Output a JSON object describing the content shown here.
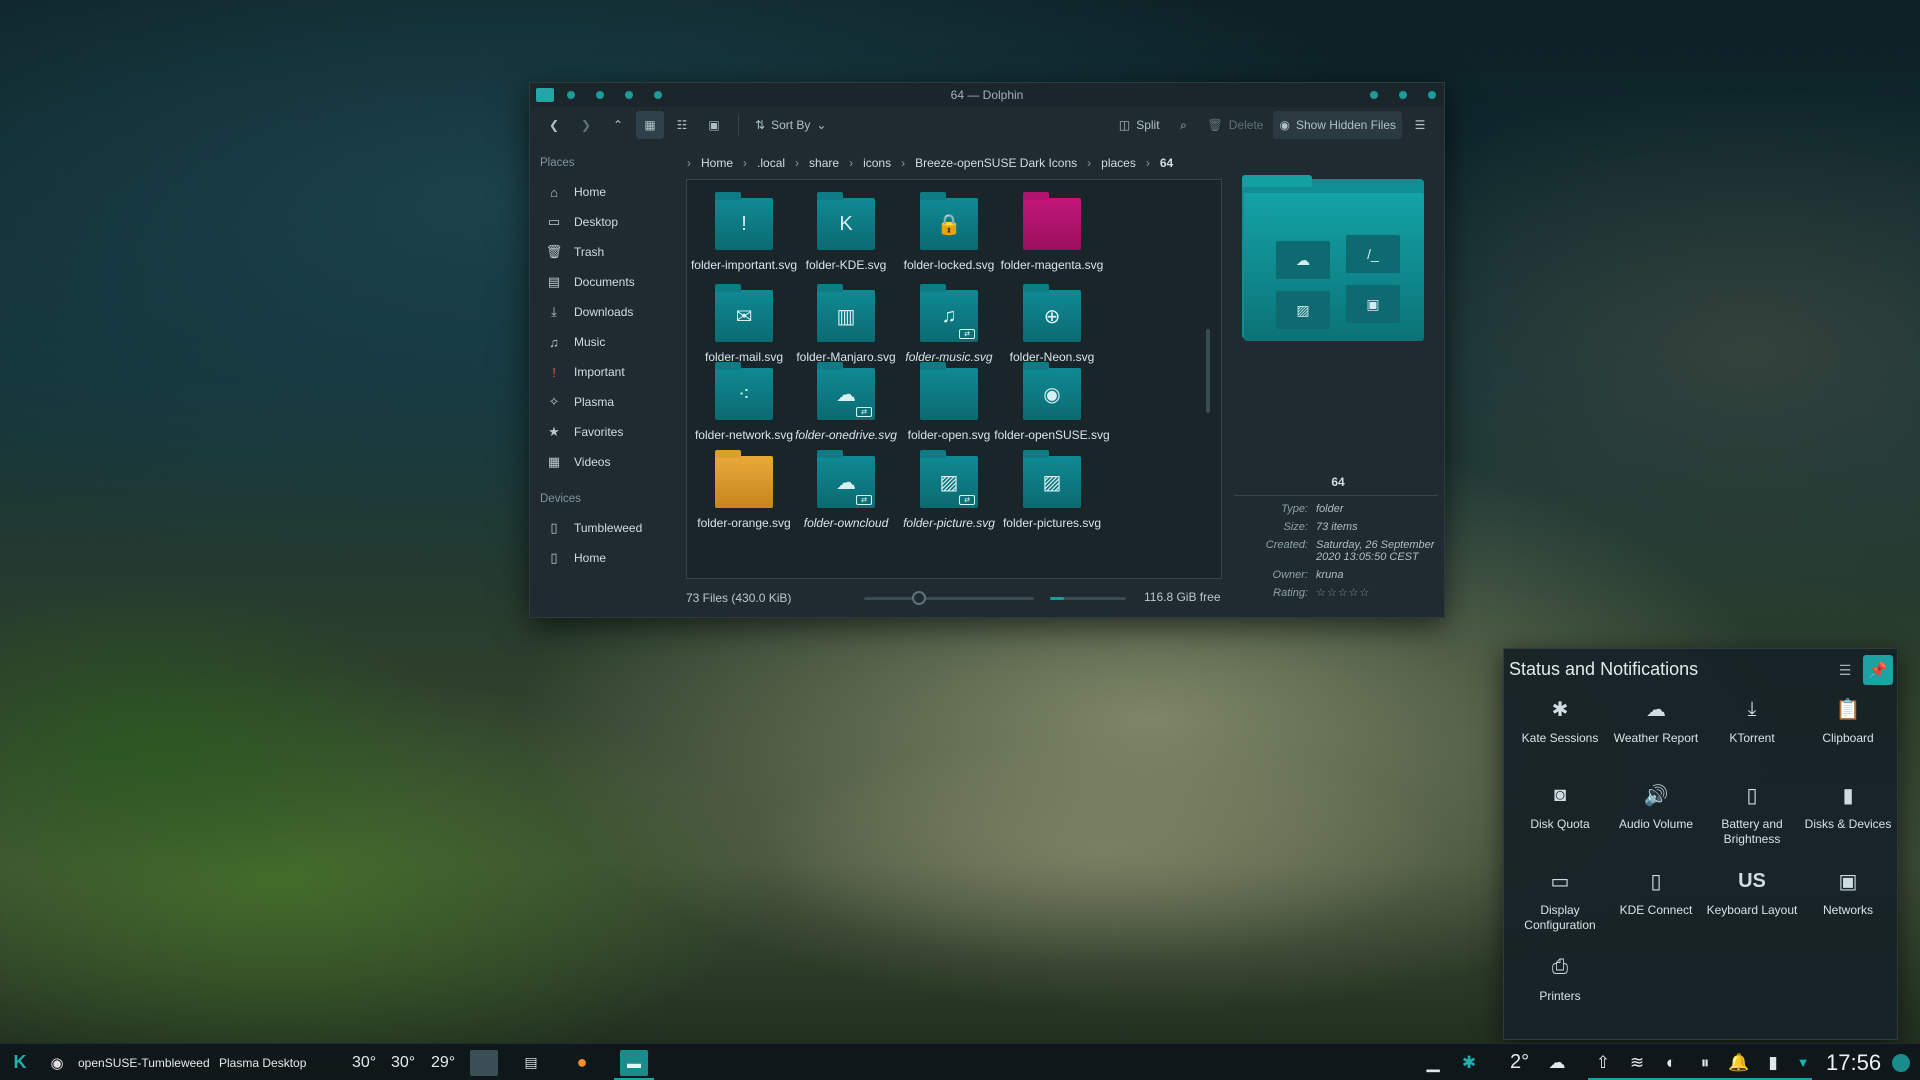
{
  "window": {
    "title": "64 — Dolphin",
    "toolbar": {
      "sort_by": "Sort By",
      "split": "Split",
      "delete": "Delete",
      "show_hidden": "Show Hidden Files"
    },
    "breadcrumb": [
      "Home",
      ".local",
      "share",
      "icons",
      "Breeze-openSUSE Dark Icons",
      "places",
      "64"
    ],
    "places_header": "Places",
    "places": [
      {
        "label": "Home",
        "icon": "home-icon"
      },
      {
        "label": "Desktop",
        "icon": "desktop-icon"
      },
      {
        "label": "Trash",
        "icon": "trash-icon"
      },
      {
        "label": "Documents",
        "icon": "documents-icon"
      },
      {
        "label": "Downloads",
        "icon": "downloads-icon"
      },
      {
        "label": "Music",
        "icon": "music-icon"
      },
      {
        "label": "Important",
        "icon": "important-icon"
      },
      {
        "label": "Plasma",
        "icon": "plasma-icon"
      },
      {
        "label": "Favorites",
        "icon": "star-icon"
      },
      {
        "label": "Videos",
        "icon": "videos-icon"
      }
    ],
    "devices_header": "Devices",
    "devices": [
      {
        "label": "Tumbleweed",
        "icon": "drive-icon"
      },
      {
        "label": "Home",
        "icon": "drive-icon"
      }
    ],
    "files": [
      {
        "name": "folder-important.svg",
        "glyph": "!",
        "style": "teal",
        "italic": false
      },
      {
        "name": "folder-KDE.svg",
        "glyph": "K",
        "style": "teal",
        "italic": false
      },
      {
        "name": "folder-locked.svg",
        "glyph": "🔒",
        "style": "teal",
        "italic": false
      },
      {
        "name": "folder-magenta.svg",
        "glyph": "",
        "style": "magenta",
        "italic": false
      },
      {
        "name": "folder-mail.svg",
        "glyph": "✉",
        "style": "teal",
        "italic": false
      },
      {
        "name": "folder-Manjaro.svg",
        "glyph": "▥",
        "style": "teal",
        "italic": false
      },
      {
        "name": "folder-music.svg",
        "glyph": "♫",
        "style": "teal",
        "italic": true
      },
      {
        "name": "folder-Neon.svg",
        "glyph": "⊕",
        "style": "teal",
        "italic": false
      },
      {
        "name": "folder-network.svg",
        "glyph": "⁖",
        "style": "teal",
        "italic": false
      },
      {
        "name": "folder-onedrive.svg",
        "glyph": "☁",
        "style": "teal",
        "italic": true
      },
      {
        "name": "folder-open.svg",
        "glyph": "",
        "style": "teal",
        "italic": false
      },
      {
        "name": "folder-openSUSE.svg",
        "glyph": "◉",
        "style": "teal",
        "italic": false
      },
      {
        "name": "folder-orange.svg",
        "glyph": "",
        "style": "orange",
        "italic": false
      },
      {
        "name": "folder-owncloud",
        "glyph": "☁",
        "style": "teal",
        "italic": true
      },
      {
        "name": "folder-picture.svg",
        "glyph": "▨",
        "style": "teal",
        "italic": true
      },
      {
        "name": "folder-pictures.svg",
        "glyph": "▨",
        "style": "teal",
        "italic": false
      }
    ],
    "info": {
      "title": "64",
      "type_label": "Type:",
      "type_value": "folder",
      "size_label": "Size:",
      "size_value": "73 items",
      "created_label": "Created:",
      "created_value": "Saturday, 26 September 2020 13:05:50 CEST",
      "owner_label": "Owner:",
      "owner_value": "kruna",
      "rating_label": "Rating:",
      "rating_value": "☆☆☆☆☆"
    },
    "status": {
      "files_summary": "73 Files (430.0 KiB)",
      "free_space": "116.8 GiB free"
    }
  },
  "notifications": {
    "title": "Status and Notifications",
    "items": [
      {
        "label": "Kate Sessions",
        "icon": "kate-icon",
        "glyph": "✱"
      },
      {
        "label": "Weather Report",
        "icon": "cloud-icon",
        "glyph": "☁"
      },
      {
        "label": "KTorrent",
        "icon": "download-icon",
        "glyph": "⤓"
      },
      {
        "label": "Clipboard",
        "icon": "clipboard-icon",
        "glyph": "📋"
      },
      {
        "label": "Disk Quota",
        "icon": "disk-quota-icon",
        "glyph": "◙"
      },
      {
        "label": "Audio Volume",
        "icon": "speaker-icon",
        "glyph": "🔊"
      },
      {
        "label": "Battery and Brightness",
        "icon": "battery-icon",
        "glyph": "▯"
      },
      {
        "label": "Disks & Devices",
        "icon": "usb-drive-icon",
        "glyph": "▮"
      },
      {
        "label": "Display Configuration",
        "icon": "monitor-icon",
        "glyph": "▭"
      },
      {
        "label": "KDE Connect",
        "icon": "phone-icon",
        "glyph": "▯"
      },
      {
        "label": "Keyboard Layout",
        "icon": "keyboard-layout-icon",
        "glyph": "US"
      },
      {
        "label": "Networks",
        "icon": "network-icon",
        "glyph": "▣"
      },
      {
        "label": "Printers",
        "icon": "printer-icon",
        "glyph": "⎙"
      }
    ]
  },
  "taskbar": {
    "activity_name": "openSUSE-Tumbleweed",
    "desktop_name": "Plasma Desktop",
    "temps": [
      "30°",
      "30°",
      "29°"
    ],
    "weather_temp": "2°",
    "clock": "17:56"
  },
  "colors": {
    "accent": "#1da1a1",
    "window_bg": "#1f2b30",
    "magenta_folder": "#c2177a",
    "orange_folder": "#e9a93a"
  }
}
